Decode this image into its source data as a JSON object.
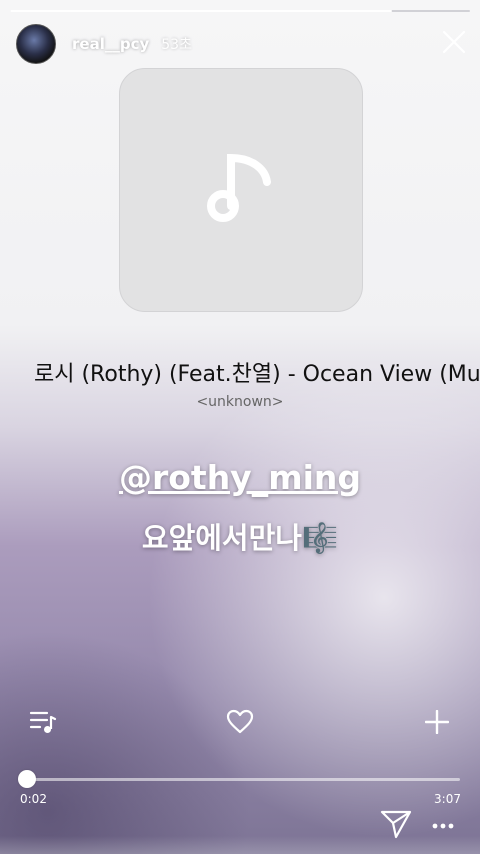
{
  "story": {
    "progress": 0.83,
    "username": "real__pcy",
    "time_ago": "53초"
  },
  "music": {
    "title": "로시 (Rothy) (Feat.찬열) - Ocean View (Mu",
    "artist": "<unknown>"
  },
  "overlay": {
    "mention": "@rothy_ming",
    "caption": "요앞에서만나🎼"
  },
  "player": {
    "elapsed": "0:02",
    "total": "3:07",
    "position_fraction": 0.011
  },
  "icons": {
    "close": "close-icon",
    "playlist": "playlist-icon",
    "like": "heart-icon",
    "add": "plus-icon",
    "send": "send-icon",
    "more": "more-icon",
    "note": "music-note-icon"
  }
}
